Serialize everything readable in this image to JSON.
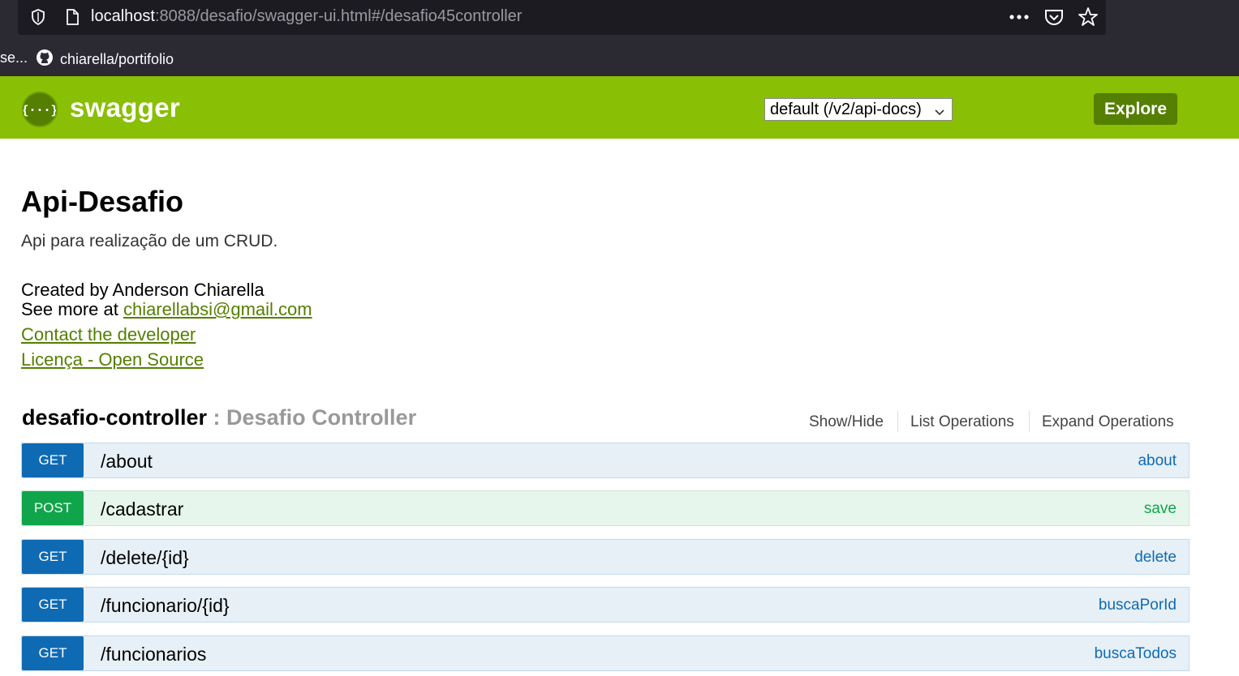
{
  "browser": {
    "url_host": "localhost",
    "url_rest": ":8088/desafio/swagger-ui.html#/desafio45controller",
    "bookmark_overflow": "se...",
    "bookmark_label": "chiarella/portifolio"
  },
  "header": {
    "title": "swagger",
    "spec_select_value": "default (/v2/api-docs)",
    "explore_label": "Explore",
    "brand_color": "#89bf04"
  },
  "info": {
    "title": "Api-Desafio",
    "description": "Api para realização de um CRUD.",
    "created_by": "Created by Anderson Chiarella",
    "see_more_prefix": "See more at ",
    "email": "chiarellabsi@gmail.com",
    "contact_label": "Contact the developer",
    "license_label": "Licença - Open Source"
  },
  "controller": {
    "name": "desafio-controller",
    "separator": " : ",
    "description": "Desafio Controller",
    "show_hide": "Show/Hide",
    "list_operations": "List Operations",
    "expand_operations": "Expand Operations",
    "operations": [
      {
        "method": "GET",
        "path": "/about",
        "operation_id": "about"
      },
      {
        "method": "POST",
        "path": "/cadastrar",
        "operation_id": "save"
      },
      {
        "method": "GET",
        "path": "/delete/{id}",
        "operation_id": "delete"
      },
      {
        "method": "GET",
        "path": "/funcionario/{id}",
        "operation_id": "buscaPorId"
      },
      {
        "method": "GET",
        "path": "/funcionarios",
        "operation_id": "buscaTodos"
      }
    ]
  }
}
